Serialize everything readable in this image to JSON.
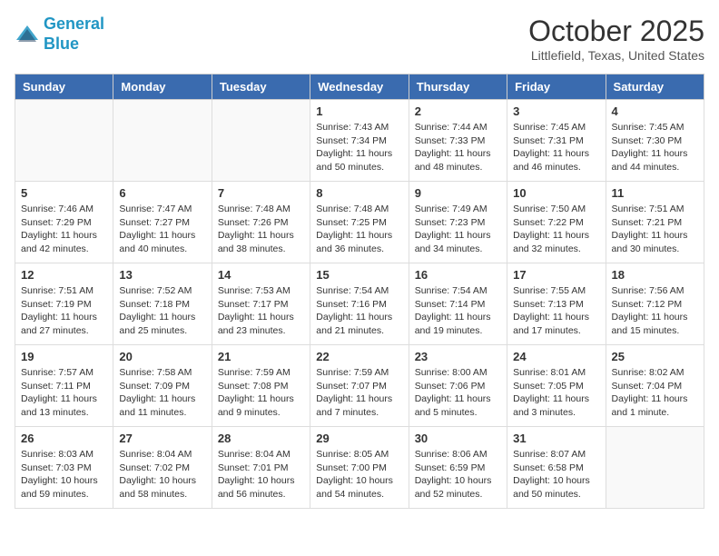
{
  "logo": {
    "line1": "General",
    "line2": "Blue"
  },
  "title": "October 2025",
  "location": "Littlefield, Texas, United States",
  "weekdays": [
    "Sunday",
    "Monday",
    "Tuesday",
    "Wednesday",
    "Thursday",
    "Friday",
    "Saturday"
  ],
  "weeks": [
    [
      {
        "day": "",
        "info": ""
      },
      {
        "day": "",
        "info": ""
      },
      {
        "day": "",
        "info": ""
      },
      {
        "day": "1",
        "info": "Sunrise: 7:43 AM\nSunset: 7:34 PM\nDaylight: 11 hours\nand 50 minutes."
      },
      {
        "day": "2",
        "info": "Sunrise: 7:44 AM\nSunset: 7:33 PM\nDaylight: 11 hours\nand 48 minutes."
      },
      {
        "day": "3",
        "info": "Sunrise: 7:45 AM\nSunset: 7:31 PM\nDaylight: 11 hours\nand 46 minutes."
      },
      {
        "day": "4",
        "info": "Sunrise: 7:45 AM\nSunset: 7:30 PM\nDaylight: 11 hours\nand 44 minutes."
      }
    ],
    [
      {
        "day": "5",
        "info": "Sunrise: 7:46 AM\nSunset: 7:29 PM\nDaylight: 11 hours\nand 42 minutes."
      },
      {
        "day": "6",
        "info": "Sunrise: 7:47 AM\nSunset: 7:27 PM\nDaylight: 11 hours\nand 40 minutes."
      },
      {
        "day": "7",
        "info": "Sunrise: 7:48 AM\nSunset: 7:26 PM\nDaylight: 11 hours\nand 38 minutes."
      },
      {
        "day": "8",
        "info": "Sunrise: 7:48 AM\nSunset: 7:25 PM\nDaylight: 11 hours\nand 36 minutes."
      },
      {
        "day": "9",
        "info": "Sunrise: 7:49 AM\nSunset: 7:23 PM\nDaylight: 11 hours\nand 34 minutes."
      },
      {
        "day": "10",
        "info": "Sunrise: 7:50 AM\nSunset: 7:22 PM\nDaylight: 11 hours\nand 32 minutes."
      },
      {
        "day": "11",
        "info": "Sunrise: 7:51 AM\nSunset: 7:21 PM\nDaylight: 11 hours\nand 30 minutes."
      }
    ],
    [
      {
        "day": "12",
        "info": "Sunrise: 7:51 AM\nSunset: 7:19 PM\nDaylight: 11 hours\nand 27 minutes."
      },
      {
        "day": "13",
        "info": "Sunrise: 7:52 AM\nSunset: 7:18 PM\nDaylight: 11 hours\nand 25 minutes."
      },
      {
        "day": "14",
        "info": "Sunrise: 7:53 AM\nSunset: 7:17 PM\nDaylight: 11 hours\nand 23 minutes."
      },
      {
        "day": "15",
        "info": "Sunrise: 7:54 AM\nSunset: 7:16 PM\nDaylight: 11 hours\nand 21 minutes."
      },
      {
        "day": "16",
        "info": "Sunrise: 7:54 AM\nSunset: 7:14 PM\nDaylight: 11 hours\nand 19 minutes."
      },
      {
        "day": "17",
        "info": "Sunrise: 7:55 AM\nSunset: 7:13 PM\nDaylight: 11 hours\nand 17 minutes."
      },
      {
        "day": "18",
        "info": "Sunrise: 7:56 AM\nSunset: 7:12 PM\nDaylight: 11 hours\nand 15 minutes."
      }
    ],
    [
      {
        "day": "19",
        "info": "Sunrise: 7:57 AM\nSunset: 7:11 PM\nDaylight: 11 hours\nand 13 minutes."
      },
      {
        "day": "20",
        "info": "Sunrise: 7:58 AM\nSunset: 7:09 PM\nDaylight: 11 hours\nand 11 minutes."
      },
      {
        "day": "21",
        "info": "Sunrise: 7:59 AM\nSunset: 7:08 PM\nDaylight: 11 hours\nand 9 minutes."
      },
      {
        "day": "22",
        "info": "Sunrise: 7:59 AM\nSunset: 7:07 PM\nDaylight: 11 hours\nand 7 minutes."
      },
      {
        "day": "23",
        "info": "Sunrise: 8:00 AM\nSunset: 7:06 PM\nDaylight: 11 hours\nand 5 minutes."
      },
      {
        "day": "24",
        "info": "Sunrise: 8:01 AM\nSunset: 7:05 PM\nDaylight: 11 hours\nand 3 minutes."
      },
      {
        "day": "25",
        "info": "Sunrise: 8:02 AM\nSunset: 7:04 PM\nDaylight: 11 hours\nand 1 minute."
      }
    ],
    [
      {
        "day": "26",
        "info": "Sunrise: 8:03 AM\nSunset: 7:03 PM\nDaylight: 10 hours\nand 59 minutes."
      },
      {
        "day": "27",
        "info": "Sunrise: 8:04 AM\nSunset: 7:02 PM\nDaylight: 10 hours\nand 58 minutes."
      },
      {
        "day": "28",
        "info": "Sunrise: 8:04 AM\nSunset: 7:01 PM\nDaylight: 10 hours\nand 56 minutes."
      },
      {
        "day": "29",
        "info": "Sunrise: 8:05 AM\nSunset: 7:00 PM\nDaylight: 10 hours\nand 54 minutes."
      },
      {
        "day": "30",
        "info": "Sunrise: 8:06 AM\nSunset: 6:59 PM\nDaylight: 10 hours\nand 52 minutes."
      },
      {
        "day": "31",
        "info": "Sunrise: 8:07 AM\nSunset: 6:58 PM\nDaylight: 10 hours\nand 50 minutes."
      },
      {
        "day": "",
        "info": ""
      }
    ]
  ]
}
